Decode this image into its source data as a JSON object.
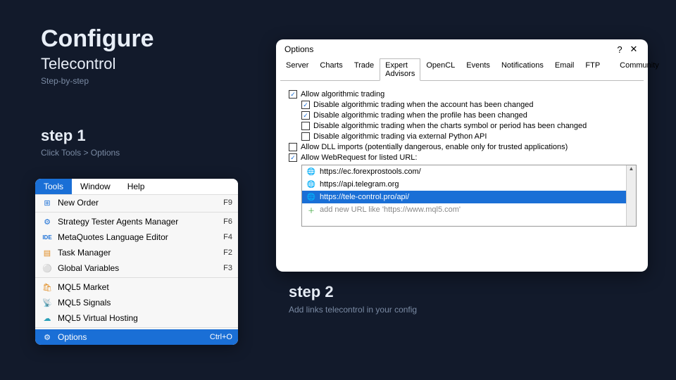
{
  "page": {
    "title": "Configure",
    "subtitle": "Telecontrol",
    "tagline": "Step-by-step"
  },
  "step1": {
    "title": "step 1",
    "subtitle": "Click Tools > Options"
  },
  "step2": {
    "title": "step 2",
    "subtitle": "Add links telecontrol in\nyour config"
  },
  "menubar": {
    "tools": "Tools",
    "window": "Window",
    "help": "Help"
  },
  "menu": {
    "new_order": {
      "label": "New Order",
      "shortcut": "F9"
    },
    "strategy_tester": {
      "label": "Strategy Tester Agents Manager",
      "shortcut": "F6"
    },
    "mq_editor": {
      "label": "MetaQuotes Language Editor",
      "shortcut": "F4"
    },
    "task_manager": {
      "label": "Task Manager",
      "shortcut": "F2"
    },
    "global_vars": {
      "label": "Global Variables",
      "shortcut": "F3"
    },
    "mql5_market": {
      "label": "MQL5 Market",
      "shortcut": ""
    },
    "mql5_signals": {
      "label": "MQL5 Signals",
      "shortcut": ""
    },
    "mql5_hosting": {
      "label": "MQL5 Virtual Hosting",
      "shortcut": ""
    },
    "options": {
      "label": "Options",
      "shortcut": "Ctrl+O"
    }
  },
  "dialog": {
    "title": "Options",
    "help": "?",
    "close": "✕",
    "tabs": {
      "server": "Server",
      "charts": "Charts",
      "trade": "Trade",
      "expert_advisors": "Expert Advisors",
      "opencl": "OpenCL",
      "events": "Events",
      "notifications": "Notifications",
      "email": "Email",
      "ftp": "FTP",
      "community": "Community"
    },
    "checks": {
      "allow_algo": "Allow algorithmic trading",
      "disable_account": "Disable algorithmic trading when the account has been changed",
      "disable_profile": "Disable algorithmic trading when the profile has been changed",
      "disable_symbol": "Disable algorithmic trading when the charts symbol or period has been changed",
      "disable_python": "Disable algorithmic trading via external Python API",
      "allow_dll": "Allow DLL imports (potentially dangerous, enable only for trusted applications)",
      "allow_webrequest": "Allow WebRequest for listed URL:"
    },
    "urls": {
      "u0": "https://ec.forexprostools.com/",
      "u1": "https://api.telegram.org",
      "u2": "https://tele-control.pro/api/",
      "add": "add new URL like 'https://www.mql5.com'"
    }
  }
}
